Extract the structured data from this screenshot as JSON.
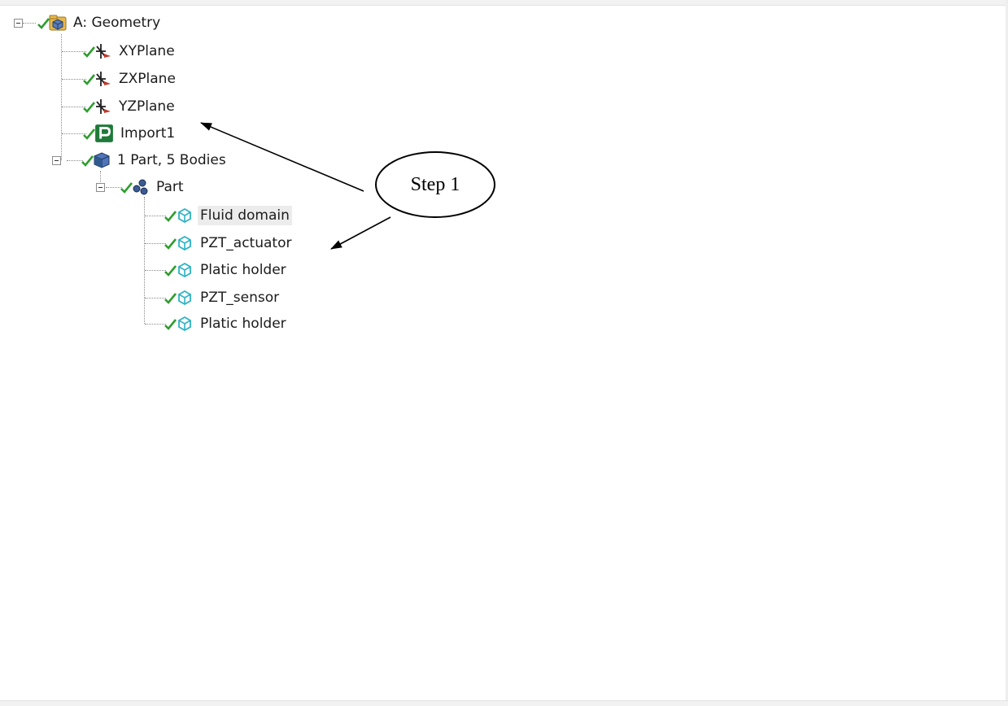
{
  "tree": {
    "root": {
      "label": "A: Geometry",
      "icon": "geometry-folder-icon",
      "status": "check-icon"
    },
    "planes": [
      {
        "label": "XYPlane",
        "icon": "plane-axes-icon"
      },
      {
        "label": "ZXPlane",
        "icon": "plane-axes-icon"
      },
      {
        "label": "YZPlane",
        "icon": "plane-axes-icon"
      }
    ],
    "import": {
      "label": "Import1",
      "icon": "import-p-icon"
    },
    "parts_group": {
      "label": "1 Part, 5 Bodies",
      "icon": "parts-cube-icon"
    },
    "part": {
      "label": "Part",
      "icon": "part-bodies-icon"
    },
    "bodies": [
      {
        "label": "Fluid domain",
        "icon": "solid-body-icon"
      },
      {
        "label": "PZT_actuator",
        "icon": "solid-body-icon"
      },
      {
        "label": "Platic holder",
        "icon": "solid-body-icon"
      },
      {
        "label": "PZT_sensor",
        "icon": "solid-body-icon"
      },
      {
        "label": "Platic holder",
        "icon": "solid-body-icon"
      }
    ]
  },
  "annotation": {
    "text": "Step 1"
  },
  "colors": {
    "check": "#2e9d2e",
    "body_icon": "#2bb3c4",
    "import_icon": "#1f7a3a",
    "selection": "#ececec"
  }
}
